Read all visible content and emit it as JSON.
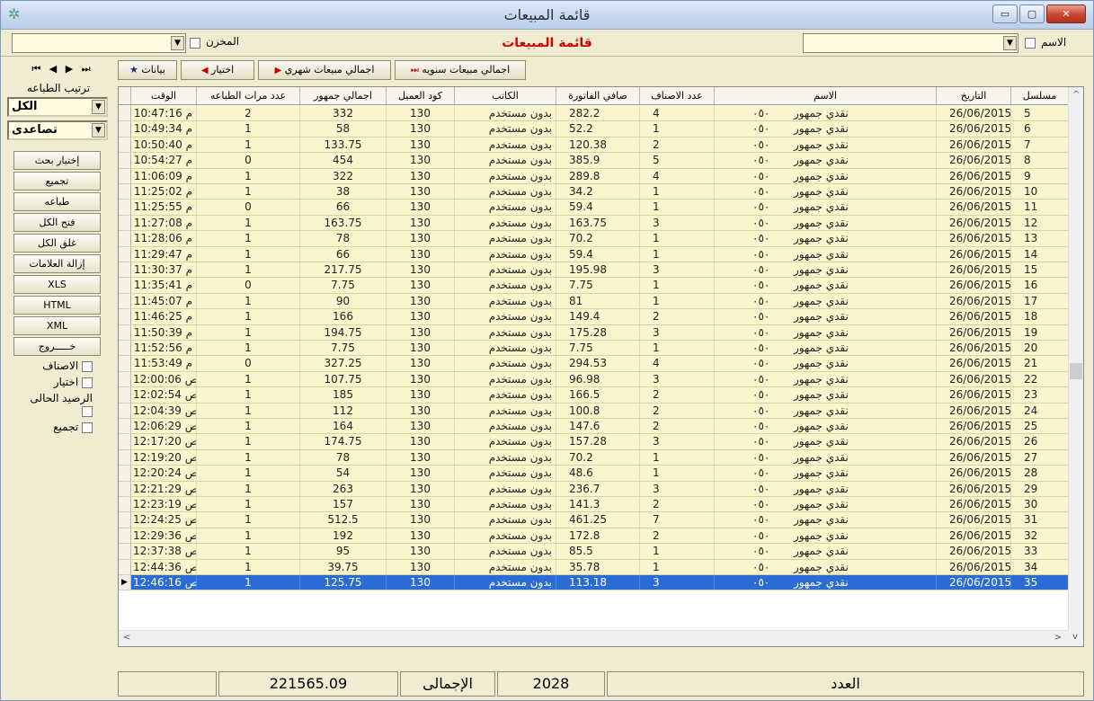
{
  "window": {
    "title": "قائمة المبيعات",
    "buttons": {
      "minimize": "▭",
      "maximize": "▢",
      "close": "✕"
    }
  },
  "filters": {
    "name_label": "الاسم",
    "store_label": "المخزن",
    "report_title": "قائمة المبيعات"
  },
  "toolbar": {
    "first": "⏮",
    "prev": "◀",
    "next": "▶",
    "last": "⏭",
    "data_label": "بيانات",
    "choose_label": "اختيار",
    "monthly_label": "اجمالي مبيعات شهري",
    "yearly_label": "اجمالي مبيعات سنويه"
  },
  "side": {
    "print_order_label": "ترتيب الطباعه",
    "scope_value": "الكل",
    "order_value": "تصاعدى",
    "buttons": [
      "إختيار بحث",
      "تجميع",
      "طباعه",
      "فتح الكل",
      "غلق الكل",
      "إزالة العلامات",
      "XLS",
      "HTML",
      "XML",
      "خـــــروج"
    ],
    "checks": [
      "الاصناف",
      "اختيار",
      "الرصيد الحالى",
      "تجميع"
    ]
  },
  "table": {
    "columns": [
      "مسلسل",
      "التاريخ",
      "الاسم",
      "عدد الاصناف",
      "صافي الفاتورة",
      "الكاتب",
      "كود العميل",
      "اجمالي جمهور",
      "عدد مرات الطباعه",
      "الوقت"
    ],
    "rows": [
      [
        "5",
        "26/06/2015",
        "نقدي جمهور",
        "٠٥٠",
        "4",
        "282.2",
        "بدون مستخدم",
        "130",
        "332",
        "2",
        "10:47:16 م"
      ],
      [
        "6",
        "26/06/2015",
        "نقدي جمهور",
        "٠٥٠",
        "1",
        "52.2",
        "بدون مستخدم",
        "130",
        "58",
        "1",
        "10:49:34 م"
      ],
      [
        "7",
        "26/06/2015",
        "نقدي جمهور",
        "٠٥٠",
        "2",
        "120.38",
        "بدون مستخدم",
        "130",
        "133.75",
        "1",
        "10:50:40 م"
      ],
      [
        "8",
        "26/06/2015",
        "نقدي جمهور",
        "٠٥٠",
        "5",
        "385.9",
        "بدون مستخدم",
        "130",
        "454",
        "0",
        "10:54:27 م"
      ],
      [
        "9",
        "26/06/2015",
        "نقدي جمهور",
        "٠٥٠",
        "4",
        "289.8",
        "بدون مستخدم",
        "130",
        "322",
        "1",
        "11:06:09 م"
      ],
      [
        "10",
        "26/06/2015",
        "نقدي جمهور",
        "٠٥٠",
        "1",
        "34.2",
        "بدون مستخدم",
        "130",
        "38",
        "1",
        "11:25:02 م"
      ],
      [
        "11",
        "26/06/2015",
        "نقدي جمهور",
        "٠٥٠",
        "1",
        "59.4",
        "بدون مستخدم",
        "130",
        "66",
        "0",
        "11:25:55 م"
      ],
      [
        "12",
        "26/06/2015",
        "نقدي جمهور",
        "٠٥٠",
        "3",
        "163.75",
        "بدون مستخدم",
        "130",
        "163.75",
        "1",
        "11:27:08 م"
      ],
      [
        "13",
        "26/06/2015",
        "نقدي جمهور",
        "٠٥٠",
        "1",
        "70.2",
        "بدون مستخدم",
        "130",
        "78",
        "1",
        "11:28:06 م"
      ],
      [
        "14",
        "26/06/2015",
        "نقدي جمهور",
        "٠٥٠",
        "1",
        "59.4",
        "بدون مستخدم",
        "130",
        "66",
        "1",
        "11:29:47 م"
      ],
      [
        "15",
        "26/06/2015",
        "نقدي جمهور",
        "٠٥٠",
        "3",
        "195.98",
        "بدون مستخدم",
        "130",
        "217.75",
        "1",
        "11:30:37 م"
      ],
      [
        "16",
        "26/06/2015",
        "نقدي جمهور",
        "٠٥٠",
        "1",
        "7.75",
        "بدون مستخدم",
        "130",
        "7.75",
        "0",
        "11:35:41 م"
      ],
      [
        "17",
        "26/06/2015",
        "نقدي جمهور",
        "٠٥٠",
        "1",
        "81",
        "بدون مستخدم",
        "130",
        "90",
        "1",
        "11:45:07 م"
      ],
      [
        "18",
        "26/06/2015",
        "نقدي جمهور",
        "٠٥٠",
        "2",
        "149.4",
        "بدون مستخدم",
        "130",
        "166",
        "1",
        "11:46:25 م"
      ],
      [
        "19",
        "26/06/2015",
        "نقدي جمهور",
        "٠٥٠",
        "3",
        "175.28",
        "بدون مستخدم",
        "130",
        "194.75",
        "1",
        "11:50:39 م"
      ],
      [
        "20",
        "26/06/2015",
        "نقدي جمهور",
        "٠٥٠",
        "1",
        "7.75",
        "بدون مستخدم",
        "130",
        "7.75",
        "1",
        "11:52:56 م"
      ],
      [
        "21",
        "26/06/2015",
        "نقدي جمهور",
        "٠٥٠",
        "4",
        "294.53",
        "بدون مستخدم",
        "130",
        "327.25",
        "0",
        "11:53:49 م"
      ],
      [
        "22",
        "26/06/2015",
        "نقدي جمهور",
        "٠٥٠",
        "3",
        "96.98",
        "بدون مستخدم",
        "130",
        "107.75",
        "1",
        "12:00:06 ص"
      ],
      [
        "23",
        "26/06/2015",
        "نقدي جمهور",
        "٠٥٠",
        "2",
        "166.5",
        "بدون مستخدم",
        "130",
        "185",
        "1",
        "12:02:54 ص"
      ],
      [
        "24",
        "26/06/2015",
        "نقدي جمهور",
        "٠٥٠",
        "2",
        "100.8",
        "بدون مستخدم",
        "130",
        "112",
        "1",
        "12:04:39 ص"
      ],
      [
        "25",
        "26/06/2015",
        "نقدي جمهور",
        "٠٥٠",
        "2",
        "147.6",
        "بدون مستخدم",
        "130",
        "164",
        "1",
        "12:06:29 ص"
      ],
      [
        "26",
        "26/06/2015",
        "نقدي جمهور",
        "٠٥٠",
        "3",
        "157.28",
        "بدون مستخدم",
        "130",
        "174.75",
        "1",
        "12:17:20 ص"
      ],
      [
        "27",
        "26/06/2015",
        "نقدي جمهور",
        "٠٥٠",
        "1",
        "70.2",
        "بدون مستخدم",
        "130",
        "78",
        "1",
        "12:19:20 ص"
      ],
      [
        "28",
        "26/06/2015",
        "نقدي جمهور",
        "٠٥٠",
        "1",
        "48.6",
        "بدون مستخدم",
        "130",
        "54",
        "1",
        "12:20:24 ص"
      ],
      [
        "29",
        "26/06/2015",
        "نقدي جمهور",
        "٠٥٠",
        "3",
        "236.7",
        "بدون مستخدم",
        "130",
        "263",
        "1",
        "12:21:29 ص"
      ],
      [
        "30",
        "26/06/2015",
        "نقدي جمهور",
        "٠٥٠",
        "2",
        "141.3",
        "بدون مستخدم",
        "130",
        "157",
        "1",
        "12:23:19 ص"
      ],
      [
        "31",
        "26/06/2015",
        "نقدي جمهور",
        "٠٥٠",
        "7",
        "461.25",
        "بدون مستخدم",
        "130",
        "512.5",
        "1",
        "12:24:25 ص"
      ],
      [
        "32",
        "26/06/2015",
        "نقدي جمهور",
        "٠٥٠",
        "2",
        "172.8",
        "بدون مستخدم",
        "130",
        "192",
        "1",
        "12:29:36 ص"
      ],
      [
        "33",
        "26/06/2015",
        "نقدي جمهور",
        "٠٥٠",
        "1",
        "85.5",
        "بدون مستخدم",
        "130",
        "95",
        "1",
        "12:37:38 ص"
      ],
      [
        "34",
        "26/06/2015",
        "نقدي جمهور",
        "٠٥٠",
        "1",
        "35.78",
        "بدون مستخدم",
        "130",
        "39.75",
        "1",
        "12:44:36 ص"
      ],
      [
        "35",
        "26/06/2015",
        "نقدي جمهور",
        "٠٥٠",
        "3",
        "113.18",
        "بدون مستخدم",
        "130",
        "125.75",
        "1",
        "12:46:16 ص"
      ]
    ],
    "selected_index": 30
  },
  "status": {
    "total_value": "221565.09",
    "total_label": "الإجمالى",
    "count_value": "2028",
    "count_label": "العدد"
  }
}
